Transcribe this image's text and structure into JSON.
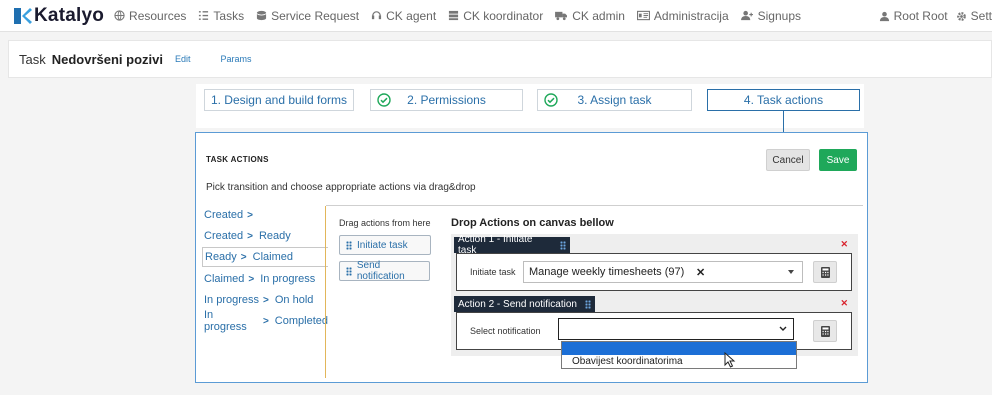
{
  "brand": {
    "name": "Katalyo",
    "logo_color": "#1f6fb0"
  },
  "nav": {
    "items": [
      {
        "label": "Resources",
        "icon": "globe-icon"
      },
      {
        "label": "Tasks",
        "icon": "list-icon"
      },
      {
        "label": "Service Request",
        "icon": "database-icon"
      },
      {
        "label": "CK agent",
        "icon": "headset-icon"
      },
      {
        "label": "CK koordinator",
        "icon": "server-icon"
      },
      {
        "label": "CK admin",
        "icon": "truck-icon"
      },
      {
        "label": "Administracija",
        "icon": "id-card-icon"
      },
      {
        "label": "Signups",
        "icon": "user-plus-icon"
      }
    ],
    "user": "Root Root",
    "settings": "Sett"
  },
  "taskbar": {
    "label": "Task",
    "name": "Nedovršeni pozivi",
    "edit": "Edit",
    "params": "Params"
  },
  "steps": [
    {
      "label": "1. Design and build forms",
      "done": false
    },
    {
      "label": "2. Permissions",
      "done": true
    },
    {
      "label": "3. Assign task",
      "done": true
    },
    {
      "label": "4. Task actions",
      "done": false
    }
  ],
  "panel": {
    "title": "TASK ACTIONS",
    "cancel": "Cancel",
    "save": "Save",
    "hint": "Pick transition and choose appropriate actions via drag&drop"
  },
  "transitions": [
    {
      "from": "Created",
      "to": ""
    },
    {
      "from": "Created",
      "to": "Ready"
    },
    {
      "from": "Ready",
      "to": "Claimed"
    },
    {
      "from": "Claimed",
      "to": "In progress"
    },
    {
      "from": "In progress",
      "to": "On hold"
    },
    {
      "from": "In progress",
      "to": "Completed"
    }
  ],
  "drag": {
    "title": "Drag actions from here",
    "items": [
      "Initiate task",
      "Send notification"
    ]
  },
  "drop": {
    "title": "Drop Actions on canvas bellow",
    "actions": [
      {
        "header": "Action 1 - Initiate task",
        "label": "Initiate task",
        "value": "Manage weekly timesheets (97)"
      },
      {
        "header": "Action 2 - Send notification",
        "label": "Select notification",
        "value": ""
      }
    ]
  },
  "dropdown": {
    "options": [
      "",
      "Obavijest koordinatorima"
    ]
  },
  "colors": {
    "accent": "#2a6fa8",
    "save": "#1fa85a",
    "close": "#d9232d",
    "header": "#1e2a3a"
  }
}
